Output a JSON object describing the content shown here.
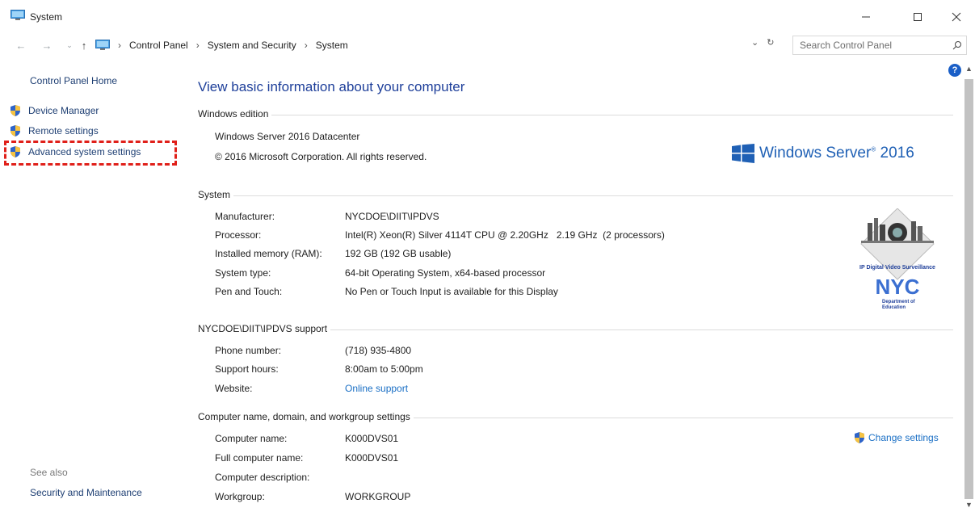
{
  "window": {
    "title": "System",
    "icon": "system-monitor-icon"
  },
  "address_bar": {
    "crumbs": [
      "Control Panel",
      "System and Security",
      "System"
    ],
    "separator": "›",
    "search_placeholder": "Search Control Panel"
  },
  "left_panel": {
    "home": "Control Panel Home",
    "items": [
      {
        "label": "Device Manager",
        "icon": "uac-shield-icon"
      },
      {
        "label": "Remote settings",
        "icon": "uac-shield-icon"
      },
      {
        "label": "Advanced system settings",
        "icon": "uac-shield-icon"
      }
    ],
    "see_also_label": "See also",
    "see_also_link": "Security and Maintenance"
  },
  "main": {
    "heading": "View basic information about your computer",
    "windows_edition": {
      "title": "Windows edition",
      "edition": "Windows Server 2016 Datacenter",
      "copyright": "© 2016 Microsoft Corporation. All rights reserved.",
      "logo_text": "Windows Server",
      "logo_year": "2016",
      "logo_reg": "®"
    },
    "system": {
      "title": "System",
      "rows": [
        {
          "label": "Manufacturer:",
          "value": "NYCDOE\\DIIT\\IPDVS"
        },
        {
          "label": "Processor:",
          "value": "Intel(R) Xeon(R) Silver 4114T CPU @ 2.20GHz   2.19 GHz  (2 processors)"
        },
        {
          "label": "Installed memory (RAM):",
          "value": "192 GB (192 GB usable)"
        },
        {
          "label": "System type:",
          "value": "64-bit Operating System, x64-based processor"
        },
        {
          "label": "Pen and Touch:",
          "value": "No Pen or Touch Input is available for this Display"
        }
      ],
      "oem_logo": {
        "caption": "IP Digital Video Surveillance",
        "brand": "NYC",
        "dept_line1": "Department of",
        "dept_line2": "Education"
      }
    },
    "support": {
      "title": "NYCDOE\\DIIT\\IPDVS support",
      "rows": [
        {
          "label": "Phone number:",
          "value": "(718) 935-4800"
        },
        {
          "label": "Support hours:",
          "value": "8:00am to 5:00pm"
        },
        {
          "label": "Website:",
          "value": "Online support"
        }
      ]
    },
    "computer_name": {
      "title": "Computer name, domain, and workgroup settings",
      "rows": [
        {
          "label": "Computer name:",
          "value": "K000DVS01"
        },
        {
          "label": "Full computer name:",
          "value": "K000DVS01"
        },
        {
          "label": "Computer description:",
          "value": ""
        },
        {
          "label": "Workgroup:",
          "value": "WORKGROUP"
        }
      ],
      "change_settings": "Change settings"
    }
  },
  "help_label": "?",
  "colors": {
    "link": "#1a6fc5",
    "heading": "#1e3f9a",
    "highlight_box": "#e0201a",
    "windows_blue": "#1f60b5"
  }
}
